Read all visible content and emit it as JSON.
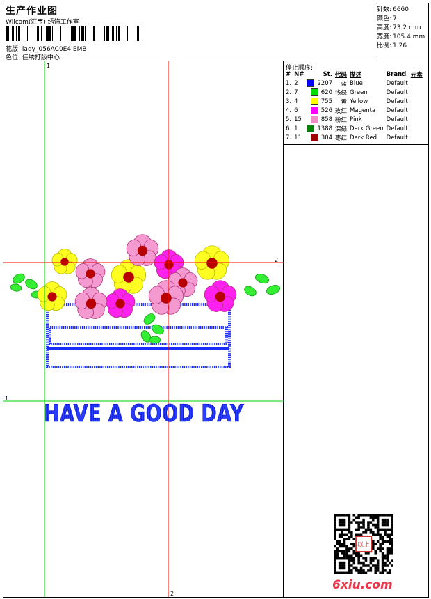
{
  "header": {
    "title": "生产作业图",
    "studio": "Wilcom(汇宝) 绣饰工作室",
    "filename_label": "花版:",
    "filename": "lady_056AC0E4.EMB",
    "color_pos_label": "色位:",
    "color_pos": "佳绣打版中心"
  },
  "stats": [
    {
      "label": "针数:",
      "value": "6660"
    },
    {
      "label": "颜色:",
      "value": "7"
    },
    {
      "label": "高度:",
      "value": "73.2 mm"
    },
    {
      "label": "宽度:",
      "value": "105.4 mm"
    },
    {
      "label": "比例:",
      "value": "1.26"
    }
  ],
  "thread_list": {
    "title": "停止顺序:",
    "columns": [
      "#",
      "N#",
      "St.",
      "代码",
      "描述",
      "Brand",
      "元素"
    ],
    "rows": [
      {
        "idx": "1.",
        "n": "2",
        "st": "2207",
        "code": "蓝",
        "desc": "Blue",
        "brand": "Default",
        "color": "#0000ff"
      },
      {
        "idx": "2.",
        "n": "7",
        "st": "620",
        "code": "浅绿",
        "desc": "Green",
        "brand": "Default",
        "color": "#00dd00"
      },
      {
        "idx": "3.",
        "n": "4",
        "st": "755",
        "code": "黄",
        "desc": "Yellow",
        "brand": "Default",
        "color": "#ffff00"
      },
      {
        "idx": "4.",
        "n": "6",
        "st": "526",
        "code": "玫红",
        "desc": "Magenta",
        "brand": "Default",
        "color": "#ff00ff"
      },
      {
        "idx": "5.",
        "n": "15",
        "st": "858",
        "code": "粉红",
        "desc": "Pink",
        "brand": "Default",
        "color": "#f08cc8"
      },
      {
        "idx": "6.",
        "n": "1",
        "st": "1388",
        "code": "深绿",
        "desc": "Dark Green",
        "brand": "Default",
        "color": "#008000"
      },
      {
        "idx": "7.",
        "n": "11",
        "st": "304",
        "code": "枣红",
        "desc": "Dark Red",
        "brand": "Default",
        "color": "#a00000"
      }
    ]
  },
  "design": {
    "text": "HAVE A GOOD DAY",
    "guide_labels": [
      "1",
      "2",
      "1",
      "2"
    ],
    "colors": {
      "guide_red": "#ff0000",
      "guide_green": "#00cc00",
      "stitch_blue": "#1a2cff"
    }
  },
  "watermark": {
    "site": "6xiu.com",
    "stamp_text": "以上"
  }
}
